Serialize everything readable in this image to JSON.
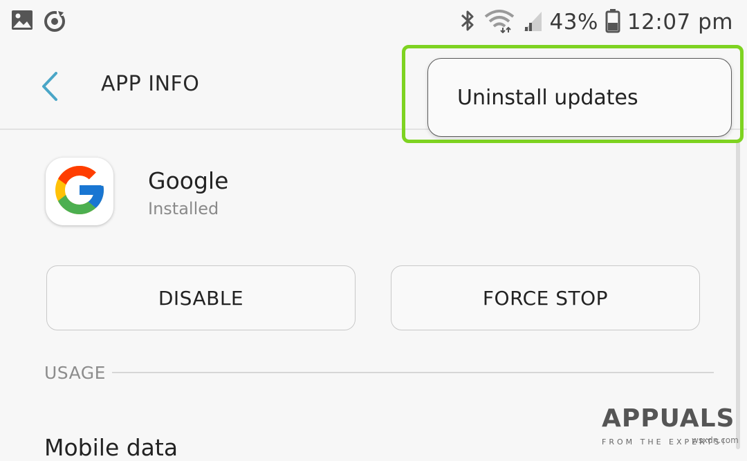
{
  "status_bar": {
    "battery_percent": "43%",
    "time": "12:07 pm",
    "icons": [
      "gallery-icon",
      "sync-icon",
      "bluetooth-icon",
      "wifi-icon",
      "cell-signal-icon",
      "battery-icon"
    ],
    "battery_level": 0.43
  },
  "app_bar": {
    "title": "APP INFO",
    "back_icon": "chevron-left-icon"
  },
  "overflow_menu": {
    "items": [
      {
        "label": "Uninstall updates"
      }
    ],
    "highlight_color": "#7ed321"
  },
  "app": {
    "name": "Google",
    "status": "Installed",
    "icon": "google-logo"
  },
  "buttons": {
    "disable": "DISABLE",
    "force_stop": "FORCE STOP"
  },
  "usage": {
    "section_label": "USAGE",
    "first_item": "Mobile data"
  },
  "watermark": {
    "brand": "APPUALS",
    "tagline": "FROM THE EXPERTS!",
    "site": "wsxdn.com"
  },
  "colors": {
    "accent": "#4aa6c7",
    "background": "#f7f7f7"
  }
}
